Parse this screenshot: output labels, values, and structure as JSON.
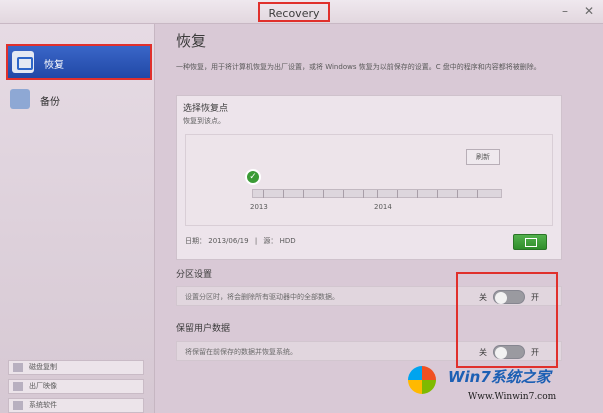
{
  "window": {
    "title": "Recovery",
    "minimize": "–",
    "close": "✕"
  },
  "sidebar": {
    "items": [
      {
        "label": "恢复",
        "icon": "restore-icon"
      },
      {
        "label": "备份",
        "icon": "backup-icon"
      }
    ],
    "tools": [
      "磁盘复制",
      "出厂映像",
      "系统软件"
    ]
  },
  "main": {
    "title": "恢复",
    "description": "一种恢复，用于将计算机恢复为出厂设置，或将 Windows 恢复为以前保存的设置。C 盘中的程序和内容都将被删除。",
    "restore_point": {
      "title": "选择恢复点",
      "subtitle": "恢复到该点。",
      "refresh_label": "刷新",
      "years": [
        "2013",
        "2014"
      ],
      "date_label": "日期：",
      "date_value": "2013/06/19",
      "source_label": "源：",
      "source_value": "HDD",
      "selected_marker": "✓"
    },
    "partition": {
      "title": "分区设置",
      "text": "设置分区时，将会删除所有驱动器中的全部数据。",
      "off_label": "关",
      "on_label": "开"
    },
    "keep_data": {
      "title": "保留用户数据",
      "text": "将保留在前保存的数据并恢复系统。",
      "off_label": "关",
      "on_label": "开"
    }
  },
  "watermark": {
    "brand": "Win7系统之家",
    "url": "Www.Winwin7.com"
  }
}
